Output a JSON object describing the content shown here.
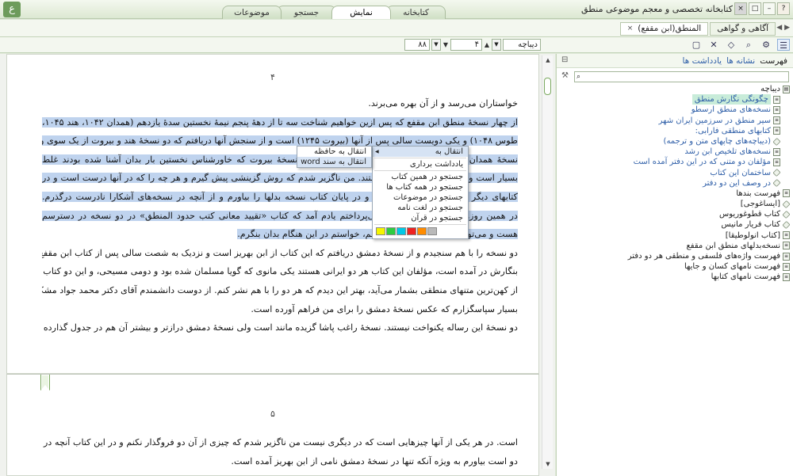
{
  "window": {
    "title": "کتابخانه تخصصی و معجم موضوعی منطق",
    "logo_glyph": "ع",
    "buttons": [
      "?",
      "–",
      "□",
      "×"
    ]
  },
  "main_tabs": [
    {
      "label": "کتابخانه",
      "active": false
    },
    {
      "label": "نمایش",
      "active": true
    },
    {
      "label": "جستجو",
      "active": false
    },
    {
      "label": "موضوعات",
      "active": false
    }
  ],
  "doc_tabs": [
    {
      "label": "آگاهی و گواهی",
      "active": false
    },
    {
      "label": "المنطق(ابن مقفع)",
      "active": true,
      "close": "×"
    }
  ],
  "toolbar": {
    "section_value": "دیباچه",
    "page_value": "۴",
    "zoom_value": "۸۸",
    "icons": [
      "list-icon",
      "gear-icon",
      "search-icon",
      "tag-icon",
      "expand-icon",
      "note-icon"
    ]
  },
  "page1": {
    "number": "۴",
    "lines": [
      {
        "text": "خواستاران می‌رسد و از آن بهره می‌برند.",
        "hl": false,
        "last": true
      },
      {
        "text": "از چهار نسخهٔ منطق ابن مقفع که پس ازین خواهیم شناخت سه تا از دههٔ پنجم نیمهٔ نخستین سدهٔ یازدهم (همدان ۱۰۴۲، هند ۱۰۴۵،",
        "hl": true,
        "last": false
      },
      {
        "text": "طوس ۱۰۴۸) و یکی دویست سالی پس از آنها (بیروت ۱۲۴۵) است و از سنجش آنها دریافتم که دو نسخهٔ هند و بیروت از یک سوی و دو",
        "hl": true,
        "last": false
      },
      {
        "text": "نسخهٔ همدان و طوس از سوی دیگر به هم نزدیک‌اند. دو نسخهٔ بیروت که خاورشناس نخستین بار بدان آشنا شده بودند غلط",
        "hl": true,
        "last": false
      },
      {
        "text": "بسیار است و نسخهٔ هند هم بی‌غلط نیستند. من ناگزیر شدم که روش گزینشی پیش گیرم و هر چه را که در آنها درست است و در",
        "hl": true,
        "last": false
      },
      {
        "text": "کتابهای دیگر هم هست در متن بگذارم و در پایان کتاب نسخه بدلها را بیاورم و از آنچه در نسخه‌های آشکارا نادرست درگذرم.",
        "hl": true,
        "last": false
      },
      {
        "text": "در همین روزها که به چاپ این متن می‌پرداختم یادم آمد که کتاب «تقیید معانی کتب حدود المنطق» در دو نسخه در دسترسم",
        "hl": true,
        "last": false
      },
      {
        "text": "هست و می‌توانم که آن را روزی نشر دهم، خواستم در این هنگام بدان بنگرم.",
        "hl": true,
        "last": true
      },
      {
        "text": "دو نسخه را با هم سنجیدم و از نسخهٔ دمشق دریافتم که این کتاب از ابن بهریز است و نزدیک به شصت سالی پس از کتاب ابن مقفع",
        "hl": false,
        "last": false
      },
      {
        "text": "بنگارش در آمده است، مؤلفان این کتاب هر دو ایرانی هستند یکی مانوی که گویا مسلمان شده بود و دومی مسیحی، و این دو کتاب هم",
        "hl": false,
        "last": false
      },
      {
        "text": "از کهن‌ترین متنهای منطقی بشمار می‌آید، بهتر این دیدم که هر دو را با هم نشر کنم. از دوست دانشمندم آقای دکتر محمد جواد مشکور",
        "hl": false,
        "last": false
      },
      {
        "text": "بسیار سپاسگزارم که عکس نسخهٔ دمشق را برای من فراهم آورده است.",
        "hl": false,
        "last": true
      },
      {
        "text": "دو نسخهٔ این رساله یکنواخت نیستند. نسخهٔ راغب پاشا گزیده مانند است ولی نسخهٔ دمشق درازتر و بیشتر آن هم در جدول گذارده شده",
        "hl": false,
        "last": false
      }
    ]
  },
  "page2": {
    "number": "۵",
    "lines": [
      {
        "text": "است. در هر یکی از آنها چیزهایی است که در دیگری نیست من ناگزیر شدم که چیزی از آن دو فروگذار نکنم و در این کتاب آنچه در هر",
        "hl": false,
        "last": false
      },
      {
        "text": "دو است بیاورم به ویژه آنکه تنها در نسخهٔ دمشق نامی از ابن بهریز آمده است.",
        "hl": false,
        "last": true
      }
    ]
  },
  "context_menu": {
    "items": [
      {
        "label": "انتقال به",
        "submenu": true,
        "selected": true
      },
      {
        "label": "یادداشت برداری",
        "sep_before": true
      },
      {
        "label": "جستجو در همین کتاب",
        "sep_before": true
      },
      {
        "label": "جستجو در همه کتاب ها"
      },
      {
        "label": "جستجو در موضوعات"
      },
      {
        "label": "جستجو در لغت نامه"
      },
      {
        "label": "جستجو در قرآن"
      }
    ],
    "swatches": [
      "#f5f500",
      "#2ecc40",
      "#00c8e6",
      "#ee2222",
      "#ff8c00",
      "#b9b9b9"
    ],
    "submenu": [
      {
        "label": "انتقال به حافظه"
      },
      {
        "label": "انتقال به سند word",
        "selected": true
      }
    ]
  },
  "side_panel": {
    "tabs": [
      {
        "label": "فهرست",
        "link": false
      },
      {
        "label": "نشانه ها",
        "link": true
      },
      {
        "label": "یادداشت ها",
        "link": true
      }
    ],
    "tree": [
      {
        "label": "دیباچه",
        "level": 0,
        "icon": "book-open-icon"
      },
      {
        "label": "چگونگی نگارش منطق",
        "level": 1,
        "icon": "page-icon",
        "link": true,
        "selected": true
      },
      {
        "label": "نسخه‌های منطق ارسطو",
        "level": 1,
        "icon": "page-icon",
        "link": true
      },
      {
        "label": "سیر منطق در سرزمین ایران شهر",
        "level": 1,
        "icon": "page-icon",
        "link": true
      },
      {
        "label": "کتابهای منطقی فارابی:",
        "level": 1,
        "icon": "page-icon",
        "link": true
      },
      {
        "label": "(دیباچه‌های چاپهای متن و ترجمه)",
        "level": 1,
        "icon": "diamond-icon",
        "link": true
      },
      {
        "label": "نسخه‌های تلخیص ابن رشد",
        "level": 1,
        "icon": "page-icon",
        "link": true
      },
      {
        "label": "مؤلفان دو متنی که در این دفتر آمده است",
        "level": 1,
        "icon": "page-icon",
        "link": true
      },
      {
        "label": "ساختمان این کتاب",
        "level": 1,
        "icon": "diamond-icon",
        "link": true
      },
      {
        "label": "در وصف این دو دفتر",
        "level": 1,
        "icon": "diamond-icon",
        "link": true
      },
      {
        "label": "فهرست بندها",
        "level": 0,
        "icon": "page-icon"
      },
      {
        "label": "[ایساغوجی]",
        "level": 0,
        "icon": "diamond-icon"
      },
      {
        "label": "کتاب قطوغوریوس",
        "level": 0,
        "icon": "diamond-icon"
      },
      {
        "label": "کتاب فریار مانیس",
        "level": 0,
        "icon": "diamond-icon"
      },
      {
        "label": "[کتاب انولوطیقا]",
        "level": 0,
        "icon": "page-icon"
      },
      {
        "label": "نسخه‌بدلهای منطق ابن مقفع",
        "level": 0,
        "icon": "page-icon"
      },
      {
        "label": "فهرست واژه‌های فلسفی و منطقی هر دو دفتر",
        "level": 0,
        "icon": "page-icon"
      },
      {
        "label": "فهرست نامهای کسان و جایها",
        "level": 0,
        "icon": "page-icon"
      },
      {
        "label": "فهرست نامهای کتابها",
        "level": 0,
        "icon": "page-icon"
      }
    ]
  }
}
